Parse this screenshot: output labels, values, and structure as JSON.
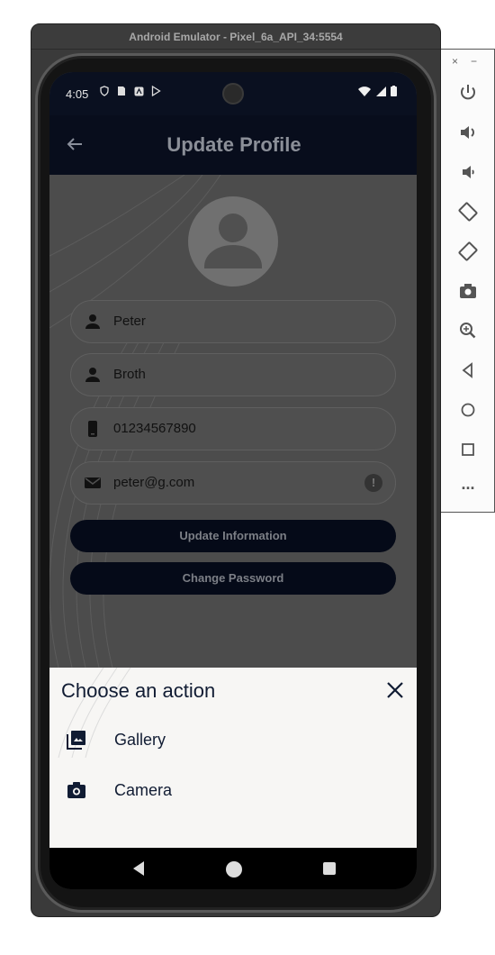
{
  "emulator": {
    "window_title": "Android Emulator - Pixel_6a_API_34:5554",
    "toolbar": {
      "close_label": "×",
      "minimize_label": "−",
      "more_label": "..."
    }
  },
  "status_bar": {
    "time": "4:05"
  },
  "app_bar": {
    "title": "Update Profile",
    "back_icon": "arrow-left-icon"
  },
  "form": {
    "first_name": "Peter",
    "last_name": "Broth",
    "phone": "01234567890",
    "email": "peter@g.com",
    "email_error_icon": "!"
  },
  "buttons": {
    "update_label": "Update Information",
    "change_password_label": "Change Password"
  },
  "sheet": {
    "title": "Choose an action",
    "items": [
      {
        "label": "Gallery",
        "icon": "gallery-icon"
      },
      {
        "label": "Camera",
        "icon": "camera-icon"
      }
    ]
  },
  "colors": {
    "app_bar": "#080d1c",
    "button": "#050a18",
    "sheet_bg": "#f7f6f4",
    "text_dark": "#111c33"
  }
}
